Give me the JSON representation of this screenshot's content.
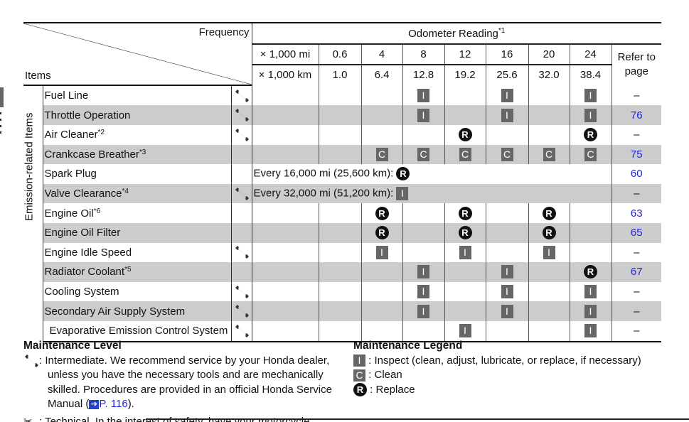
{
  "header": {
    "frequency_label": "Frequency",
    "items_label": "Items",
    "odometer_label": "Odometer Reading",
    "odometer_note": "*1",
    "unit_mi": "× 1,000 mi",
    "unit_km": "× 1,000 km",
    "miles": [
      "0.6",
      "4",
      "8",
      "12",
      "16",
      "20",
      "24"
    ],
    "km": [
      "1.0",
      "6.4",
      "12.8",
      "19.2",
      "25.6",
      "32.0",
      "38.4"
    ],
    "refer_line1": "Refer to",
    "refer_line2": "page"
  },
  "group_label": "Emission-related Items",
  "rows": [
    {
      "name": "Fuel Line",
      "note": "",
      "level": "intermediate",
      "marks": [
        "",
        "",
        "I",
        "",
        "I",
        "",
        "I"
      ],
      "page": "–"
    },
    {
      "name": "Throttle Operation",
      "note": "",
      "level": "intermediate",
      "marks": [
        "",
        "",
        "I",
        "",
        "I",
        "",
        "I"
      ],
      "page": "76"
    },
    {
      "name": "Air Cleaner",
      "note": "*2",
      "level": "intermediate",
      "marks": [
        "",
        "",
        "",
        "R",
        "",
        "",
        "R"
      ],
      "page": "–"
    },
    {
      "name": "Crankcase Breather",
      "note": "*3",
      "level": "",
      "marks": [
        "",
        "C",
        "C",
        "C",
        "C",
        "C",
        "C"
      ],
      "page": "75"
    },
    {
      "name": "Spark Plug",
      "note": "",
      "level": "",
      "every": "Every 16,000 mi (25,600 km):",
      "every_mark": "R",
      "page": "60"
    },
    {
      "name": "Valve Clearance",
      "note": "*4",
      "level": "intermediate",
      "every": "Every 32,000 mi (51,200 km):",
      "every_mark": "I",
      "page": "–"
    },
    {
      "name": "Engine Oil",
      "note": "*6",
      "level": "",
      "marks": [
        "",
        "R",
        "",
        "R",
        "",
        "R",
        ""
      ],
      "page": "63"
    },
    {
      "name": "Engine Oil Filter",
      "note": "",
      "level": "",
      "marks": [
        "",
        "R",
        "",
        "R",
        "",
        "R",
        ""
      ],
      "page": "65"
    },
    {
      "name": "Engine Idle Speed",
      "note": "",
      "level": "intermediate",
      "marks": [
        "",
        "I",
        "",
        "I",
        "",
        "I",
        ""
      ],
      "page": "–"
    },
    {
      "name": "Radiator Coolant",
      "note": "*5",
      "level": "",
      "marks": [
        "",
        "",
        "I",
        "",
        "I",
        "",
        "R"
      ],
      "page": "67"
    },
    {
      "name": "Cooling System",
      "note": "",
      "level": "intermediate",
      "marks": [
        "",
        "",
        "I",
        "",
        "I",
        "",
        "I"
      ],
      "page": "–"
    },
    {
      "name": "Secondary Air Supply System",
      "note": "",
      "level": "intermediate",
      "marks": [
        "",
        "",
        "I",
        "",
        "I",
        "",
        "I"
      ],
      "page": "–"
    },
    {
      "name": "Evaporative Emission Control System",
      "note": "",
      "level": "intermediate",
      "marks": [
        "",
        "",
        "",
        "I",
        "",
        "",
        "I"
      ],
      "page": "–"
    }
  ],
  "maintenance_level": {
    "title": "Maintenance Level",
    "intermediate_text_1": ": Intermediate. We recommend service by your Honda dealer,",
    "intermediate_text_2": "unless you have the necessary tools and are mechanically",
    "intermediate_text_3": "skilled. Procedures are provided in an official Honda Service",
    "intermediate_text_4": "Manual (",
    "link_text": "P. 116",
    "intermediate_text_5": ").",
    "technical_text": ": Technical. In the interest of safety, have your motorcycle"
  },
  "maintenance_legend": {
    "title": "Maintenance Legend",
    "items": [
      {
        "mark": "I",
        "text": ": Inspect (clean, adjust, lubricate, or replace, if necessary)"
      },
      {
        "mark": "C",
        "text": ": Clean"
      },
      {
        "mark": "R",
        "text": ": Replace"
      }
    ]
  },
  "colors": {
    "row_shade": "#cccccc",
    "mark_gray": "#666666",
    "link_blue": "#2222dd"
  }
}
